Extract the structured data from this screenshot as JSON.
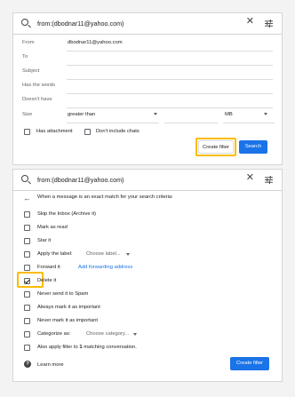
{
  "panel_top": {
    "query": "from:(dbodnar11@yahoo.com)",
    "fields": [
      {
        "label": "From",
        "value": "dbodnar11@yahoo.com"
      },
      {
        "label": "To",
        "value": ""
      },
      {
        "label": "Subject",
        "value": ""
      },
      {
        "label": "Has the words",
        "value": ""
      },
      {
        "label": "Doesn't have",
        "value": ""
      }
    ],
    "size": {
      "label": "Size",
      "comparator": "greater than",
      "value": "",
      "unit": "MB"
    },
    "has_attachment": {
      "label": "Has attachment",
      "checked": false
    },
    "dont_include_chats": {
      "label": "Don't include chats",
      "checked": false
    },
    "create_filter_label": "Create filter",
    "search_label": "Search"
  },
  "panel_bottom": {
    "query": "from:(dbodnar11@yahoo.com)",
    "criteria_text": "When a message is an exact match for your search criteria:",
    "options": [
      {
        "label": "Skip the Inbox (Archive it)",
        "checked": false
      },
      {
        "label": "Mark as read",
        "checked": false
      },
      {
        "label": "Star it",
        "checked": false
      },
      {
        "label": "Apply the label:",
        "dropdown": "Choose label...",
        "checked": false
      },
      {
        "label": "Forward it",
        "link": "Add forwarding address",
        "checked": false
      },
      {
        "label": "Delete it",
        "checked": true
      },
      {
        "label": "Never send it to Spam",
        "checked": false
      },
      {
        "label": "Always mark it as important",
        "checked": false
      },
      {
        "label": "Never mark it as important",
        "checked": false
      },
      {
        "label": "Categorize as:",
        "dropdown": "Choose category...",
        "checked": false
      },
      {
        "label_prefix": "Also apply filter to ",
        "label_count": "1",
        "label_suffix": " matching conversation.",
        "checked": false
      }
    ],
    "learn_more": "Learn more",
    "create_filter_label": "Create filter"
  },
  "colors": {
    "accent": "#1a73e8",
    "highlight": "#fbbc04"
  },
  "icons": [
    "search-icon",
    "close-icon",
    "tune-icon",
    "back-arrow-icon",
    "help-icon",
    "checkbox-checked-icon"
  ]
}
